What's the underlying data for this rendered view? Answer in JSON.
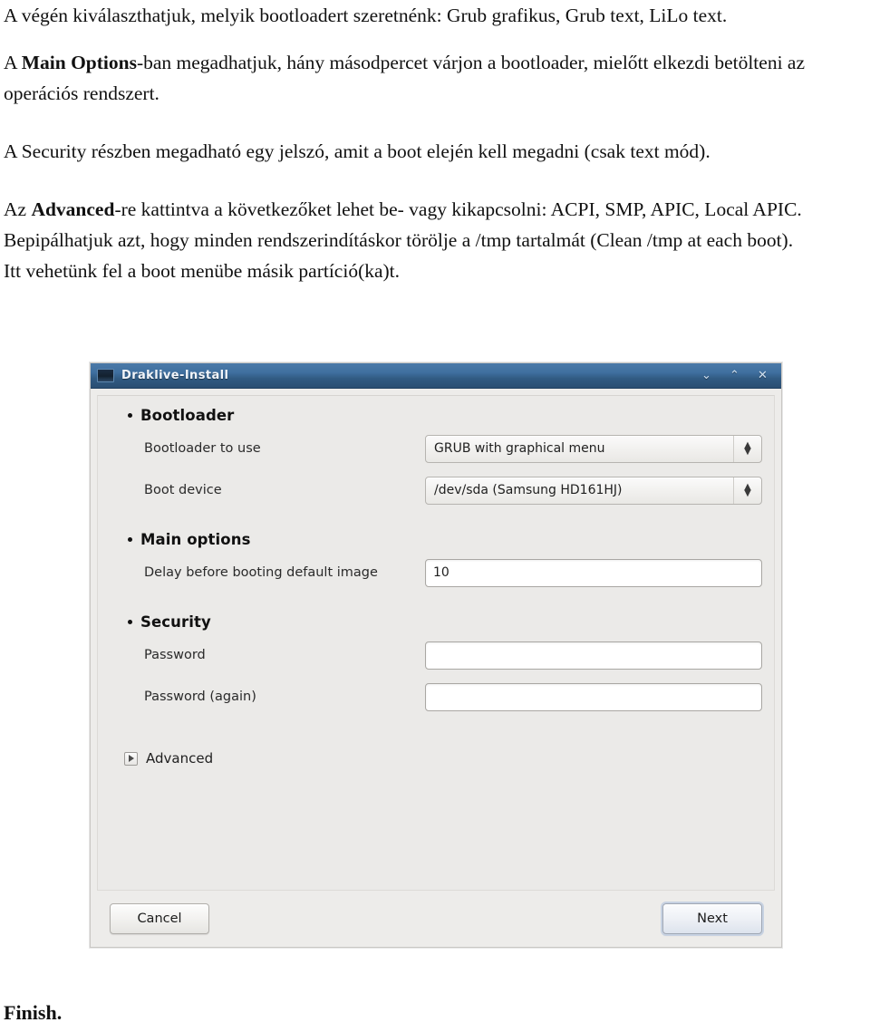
{
  "document": {
    "paragraphs": [
      {
        "id": "p1",
        "runs": [
          {
            "text": "A végén kiválaszthatjuk, melyik bootloadert szeretnénk: Grub grafikus, Grub text, LiLo text.",
            "bold": false
          }
        ]
      },
      {
        "id": "p2",
        "runs": [
          {
            "text": "A ",
            "bold": false
          },
          {
            "text": "Main Options",
            "bold": true
          },
          {
            "text": "-ban megadhatjuk, hány másodpercet várjon a bootloader, mielőtt elkezdi betölteni az operációs rendszert.",
            "bold": false
          }
        ]
      },
      {
        "id": "p3",
        "runs": [
          {
            "text": "A Security részben megadható egy jelszó, amit a boot elején kell megadni (csak text mód).",
            "bold": false
          }
        ]
      },
      {
        "id": "p4",
        "runs": [
          {
            "text": "Az ",
            "bold": false
          },
          {
            "text": "Advanced",
            "bold": true
          },
          {
            "text": "-re kattintva a következőket lehet be- vagy kikapcsolni: ACPI, SMP, APIC, Local APIC. Bepipálhatjuk azt, hogy minden rendszerindításkor törölje a /tmp tartalmát (Clean /tmp at each boot).",
            "bold": false
          }
        ]
      },
      {
        "id": "p5",
        "runs": [
          {
            "text": "Itt vehetünk fel a boot menübe másik partíció(ka)t.",
            "bold": false
          }
        ]
      }
    ],
    "closing": "Finish."
  },
  "screenshot": {
    "window": {
      "title": "Draklive-Install",
      "icon": "application-icon",
      "controls": {
        "minimize": "⌄",
        "maximize": "⌃",
        "close": "✕"
      },
      "titlebar_color": "#3f6f9f"
    },
    "sections": [
      {
        "id": "bootloader",
        "heading": "Bootloader",
        "rows": [
          {
            "id": "bootloader-to-use",
            "label": "Bootloader to use",
            "control": "combobox",
            "value": "GRUB with graphical menu"
          },
          {
            "id": "boot-device",
            "label": "Boot device",
            "control": "combobox",
            "value": "/dev/sda (Samsung HD161HJ)"
          }
        ]
      },
      {
        "id": "main-options",
        "heading": "Main options",
        "rows": [
          {
            "id": "delay-before-booting",
            "label": "Delay before booting default image",
            "control": "entry",
            "value": "10"
          }
        ]
      },
      {
        "id": "security",
        "heading": "Security",
        "rows": [
          {
            "id": "password",
            "label": "Password",
            "control": "entry",
            "value": ""
          },
          {
            "id": "password-again",
            "label": "Password (again)",
            "control": "entry",
            "value": ""
          }
        ]
      }
    ],
    "expander": {
      "label": "Advanced",
      "icon": "triangle-right-icon",
      "expanded": false
    },
    "buttons": {
      "cancel": "Cancel",
      "next": "Next"
    }
  }
}
